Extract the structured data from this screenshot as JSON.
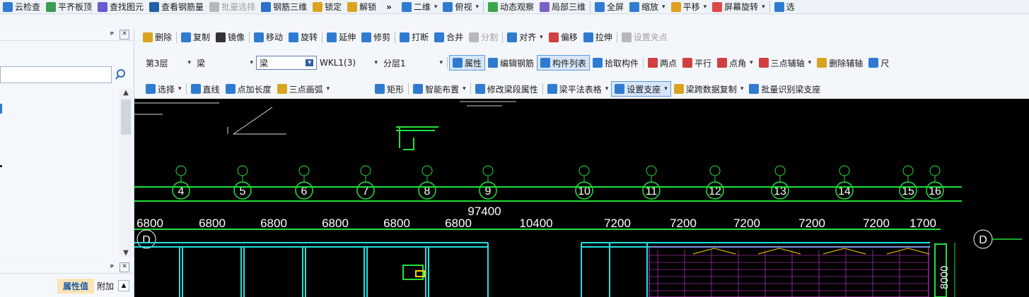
{
  "toolbar1": {
    "items": [
      {
        "label": "云检查",
        "icon": "cloud-check-icon",
        "color": "#2f7bd1"
      },
      {
        "label": "平齐板顶",
        "icon": "align-slab-top-icon",
        "color": "#3d9b52"
      },
      {
        "label": "查找图元",
        "icon": "binoculars-icon",
        "color": "#6a5acd"
      },
      {
        "label": "查看钢筋量",
        "icon": "rebar-quantity-icon",
        "color": "#1f5fa8"
      },
      {
        "label": "批量选择",
        "icon": "batch-select-icon",
        "color": "#b8b8b8",
        "disabled": true
      },
      {
        "label": "钢筋三维",
        "icon": "rebar-3d-icon",
        "color": "#2a6fc9"
      },
      {
        "label": "锁定",
        "icon": "lock-icon",
        "color": "#d9a520"
      },
      {
        "label": "解锁",
        "icon": "unlock-icon",
        "color": "#d9a520"
      }
    ],
    "overflow": "»",
    "right_items": [
      {
        "label": "二维",
        "icon": "2d-view-icon",
        "color": "#2f7bd1",
        "dropdown": true
      },
      {
        "label": "俯视",
        "icon": "top-view-icon",
        "color": "#2f7bd1",
        "dropdown": true
      },
      {
        "label": "动态观察",
        "icon": "orbit-icon",
        "color": "#3aa64b"
      },
      {
        "label": "局部三维",
        "icon": "local-3d-icon",
        "color": "#7b5fc4"
      },
      {
        "label": "全屏",
        "icon": "fullscreen-icon",
        "color": "#2f7bd1"
      },
      {
        "label": "缩放",
        "icon": "zoom-icon",
        "color": "#2f7bd1",
        "dropdown": true
      },
      {
        "label": "平移",
        "icon": "pan-icon",
        "color": "#e0a020",
        "dropdown": true
      },
      {
        "label": "屏幕旋转",
        "icon": "screen-rotate-icon",
        "color": "#e04848",
        "dropdown": true
      },
      {
        "label": "选",
        "icon": "select-icon",
        "color": "#2f7bd1"
      }
    ]
  },
  "toolbar2": {
    "items": [
      {
        "label": "删除",
        "icon": "delete-icon",
        "color": "#d9a520"
      },
      {
        "label": "复制",
        "icon": "copy-icon",
        "color": "#2f7bd1"
      },
      {
        "label": "镜像",
        "icon": "mirror-icon",
        "color": "#333333"
      },
      {
        "label": "移动",
        "icon": "move-icon",
        "color": "#2f7bd1"
      },
      {
        "label": "旋转",
        "icon": "rotate-icon",
        "color": "#2f7bd1"
      },
      {
        "label": "延伸",
        "icon": "extend-icon",
        "color": "#2f7bd1"
      },
      {
        "label": "修剪",
        "icon": "trim-icon",
        "color": "#2f7bd1"
      },
      {
        "label": "打断",
        "icon": "break-icon",
        "color": "#2f7bd1"
      },
      {
        "label": "合并",
        "icon": "merge-icon",
        "color": "#2f7bd1"
      },
      {
        "label": "分割",
        "icon": "split-icon",
        "color": "#b8b8b8",
        "disabled": true
      },
      {
        "label": "对齐",
        "icon": "align-icon",
        "color": "#2f7bd1",
        "dropdown": true
      },
      {
        "label": "偏移",
        "icon": "offset-icon",
        "color": "#d04040"
      },
      {
        "label": "拉伸",
        "icon": "stretch-icon",
        "color": "#2f7bd1"
      },
      {
        "label": "设置夹点",
        "icon": "grip-icon",
        "color": "#b8b8b8",
        "disabled": true
      }
    ]
  },
  "toolbar3": {
    "floor": "第3层",
    "category": "梁",
    "subcategory": "梁",
    "element": "WKL1(3)",
    "layer": "分层1",
    "buttons": [
      {
        "label": "属性",
        "icon": "properties-icon",
        "color": "#2f7bd1",
        "active": true
      },
      {
        "label": "编辑钢筋",
        "icon": "edit-rebar-icon",
        "color": "#2f7bd1"
      },
      {
        "label": "构件列表",
        "icon": "component-list-icon",
        "color": "#2f7bd1",
        "active": true
      },
      {
        "label": "拾取构件",
        "icon": "pick-component-icon",
        "color": "#2f7bd1"
      }
    ],
    "axis_buttons": [
      {
        "label": "两点",
        "icon": "two-point-icon",
        "color": "#d04040"
      },
      {
        "label": "平行",
        "icon": "parallel-icon",
        "color": "#d04040"
      },
      {
        "label": "点角",
        "icon": "point-angle-icon",
        "color": "#d04040",
        "dropdown": true
      },
      {
        "label": "三点辅轴",
        "icon": "three-point-axis-icon",
        "color": "#d04040",
        "dropdown": true
      },
      {
        "label": "删除辅轴",
        "icon": "delete-axis-icon",
        "color": "#d9a520"
      },
      {
        "label": "尺",
        "icon": "ruler-icon",
        "color": "#2f7bd1"
      }
    ]
  },
  "toolbar4": {
    "items": [
      {
        "label": "选择",
        "icon": "select-arrow-icon",
        "color": "#2f7bd1",
        "dropdown": true
      },
      {
        "label": "直线",
        "icon": "line-icon",
        "color": "#2f7bd1"
      },
      {
        "label": "点加长度",
        "icon": "point-length-icon",
        "color": "#2f7bd1"
      },
      {
        "label": "三点画弧",
        "icon": "arc-icon",
        "color": "#d9a520",
        "dropdown": true
      }
    ],
    "items2": [
      {
        "label": "矩形",
        "icon": "rectangle-icon",
        "color": "#2f7bd1"
      },
      {
        "label": "智能布置",
        "icon": "smart-layout-icon",
        "color": "#2f7bd1",
        "dropdown": true
      },
      {
        "label": "修改梁段属性",
        "icon": "modify-beam-icon",
        "color": "#2f7bd1"
      },
      {
        "label": "梁平法表格",
        "icon": "beam-table-icon",
        "color": "#2f7bd1",
        "dropdown": true
      },
      {
        "label": "设置支座",
        "icon": "set-support-icon",
        "color": "#2f7bd1",
        "dropdown": true,
        "active": true
      },
      {
        "label": "梁跨数据复制",
        "icon": "span-copy-icon",
        "color": "#d9a520",
        "dropdown": true
      },
      {
        "label": "批量识别梁支座",
        "icon": "batch-support-icon",
        "color": "#2f7bd1"
      }
    ]
  },
  "panel": {
    "pin": "ᵖ",
    "close": "✕",
    "search_value": "",
    "search_placeholder": "",
    "tabs": [
      "属性值",
      "附加"
    ]
  },
  "drawing": {
    "grid_labels": [
      "4",
      "5",
      "6",
      "7",
      "8",
      "9",
      "10",
      "11",
      "12",
      "13",
      "14",
      "15",
      "16"
    ],
    "dimensions": [
      "6800",
      "6800",
      "6800",
      "6800",
      "6800",
      "6800",
      "10400",
      "7200",
      "7200",
      "7200",
      "7200",
      "7200",
      "1700"
    ],
    "total": "97400",
    "row_label": "D",
    "side_dim": "8000",
    "colors": {
      "grid": "#22e03a",
      "dim": "#ffffff",
      "axis": "#22e03a",
      "wall": "#22e0e0",
      "magenta": "#e040e0",
      "yellow": "#ffd200",
      "red": "#ff3030"
    }
  }
}
